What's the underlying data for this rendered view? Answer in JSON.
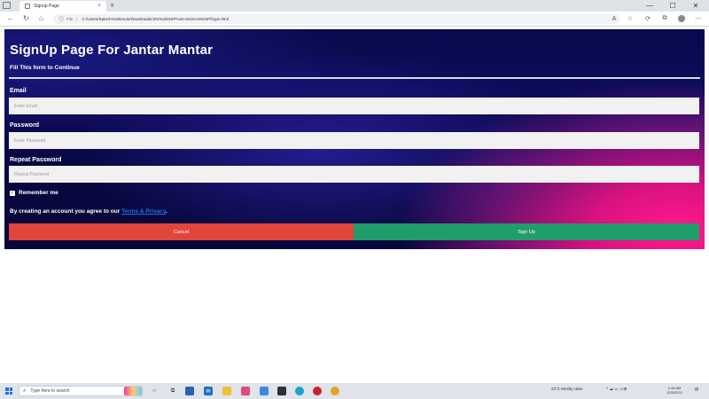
{
  "browser": {
    "tab_title": "Signup Page",
    "tab_close": "×",
    "new_tab": "+",
    "address_info": "ⓘ",
    "address_scheme": "File",
    "address_url": "C:/Users/Kptech%20Irsulo/Downloads/JSS%20SSP%20-SSS%20GSP/login.html"
  },
  "page": {
    "title": "SignUp Page For Jantar Mantar",
    "subtitle": "Fill This form to Continue",
    "email_label": "Email",
    "email_placeholder": "Enter Email",
    "password_label": "Password",
    "password_placeholder": "Enter Password",
    "repeat_label": "Repeat Password",
    "repeat_placeholder": "Repeat Password",
    "remember_label": "Remember me",
    "remember_checked": true,
    "terms_prefix": "By creating an account you agree to our ",
    "terms_link": "Terms & Privacy",
    "terms_suffix": ".",
    "cancel_label": "Cancel",
    "signup_label": "Sign Up"
  },
  "taskbar": {
    "search_placeholder": "Type here to search",
    "weather": "22°C  Mostly clear",
    "time": "4:18 AM",
    "date": "12/5/2022"
  },
  "colors": {
    "cancel": "#e2453c",
    "signup": "#1f9d6b",
    "link": "#1a73e8"
  }
}
